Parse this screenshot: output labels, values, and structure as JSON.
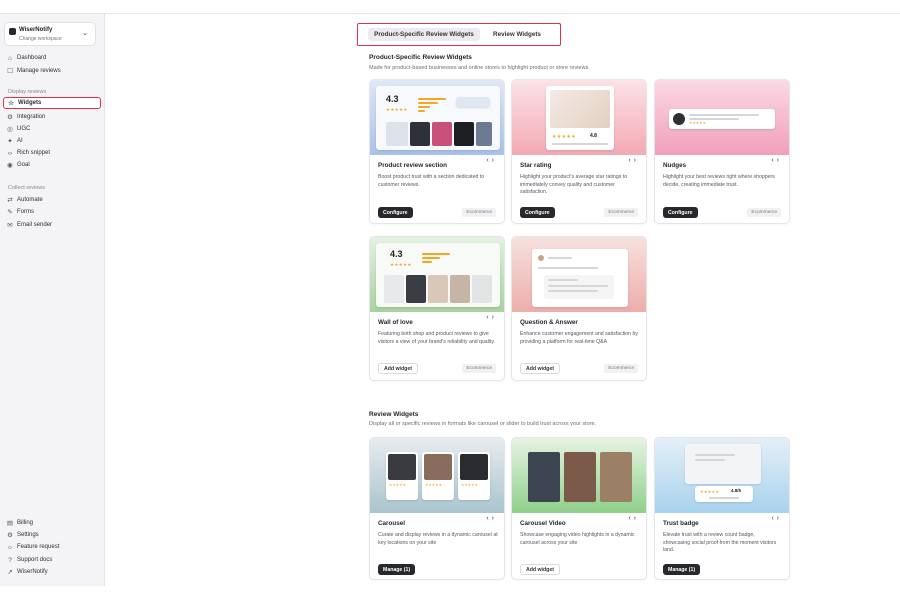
{
  "workspace": {
    "name": "WiserNotify",
    "subtitle": "Change workspace"
  },
  "sidebar": {
    "top_items": [
      {
        "label": "Dashboard",
        "icon": "home-icon"
      },
      {
        "label": "Manage reviews",
        "icon": "reviews-icon"
      }
    ],
    "display_label": "Display reviews",
    "display_items": [
      {
        "label": "Widgets",
        "icon": "star-icon",
        "active": true
      },
      {
        "label": "Integration",
        "icon": "integration-icon"
      },
      {
        "label": "UGC",
        "icon": "ugc-icon"
      },
      {
        "label": "AI",
        "icon": "ai-icon"
      },
      {
        "label": "Rich snippet",
        "icon": "code-icon"
      },
      {
        "label": "Goal",
        "icon": "goal-icon"
      }
    ],
    "collect_label": "Collect reviews",
    "collect_items": [
      {
        "label": "Automate",
        "icon": "automate-icon"
      },
      {
        "label": "Forms",
        "icon": "forms-icon"
      },
      {
        "label": "Email sender",
        "icon": "email-icon"
      }
    ],
    "bottom_items": [
      {
        "label": "Billing",
        "icon": "billing-icon"
      },
      {
        "label": "Settings",
        "icon": "settings-icon"
      },
      {
        "label": "Feature request",
        "icon": "bulb-icon"
      },
      {
        "label": "Support docs",
        "icon": "help-icon"
      },
      {
        "label": "WiserNotify",
        "icon": "external-link-icon"
      }
    ]
  },
  "tabs": {
    "active": "Product-Specific Review Widgets",
    "inactive": "Review Widgets"
  },
  "product_section": {
    "title": "Product-Specific Review Widgets",
    "description": "Made for product-based businesses and online stores to highlight product or store reviews.",
    "cards": [
      {
        "title": "Product review section",
        "description": "Boost product trust with a section dedicated to customer reviews.",
        "button": "Configure",
        "tag": "Ecommerce",
        "rating": "4.3"
      },
      {
        "title": "Star rating",
        "description": "Highlight your product's average star ratings to immediately convey quality and customer satisfaction.",
        "button": "Configure",
        "tag": "Ecommerce",
        "rating": "4.8"
      },
      {
        "title": "Nudges",
        "description": "Highlight your best reviews right where shoppers decide, creating immediate trust.",
        "button": "Configure",
        "tag": "Ecommerce"
      },
      {
        "title": "Wall of love",
        "description": "Featuring both shop and product reviews to give visitors a view of your brand's reliability and quality.",
        "button": "Add widget",
        "tag": "Ecommerce",
        "rating": "4.3"
      },
      {
        "title": "Question & Answer",
        "description": "Enhance customer engagement and satisfaction by providing a platform for real-time Q&A",
        "button": "Add widget",
        "tag": "Ecommerce"
      }
    ]
  },
  "review_section": {
    "title": "Review Widgets",
    "description": "Display all or specific reviews in formats like carousel or slider to build trust across your store.",
    "cards": [
      {
        "title": "Carousel",
        "description": "Curate and display reviews in a dynamic carousel at key locations on your site",
        "button": "Manage (1)"
      },
      {
        "title": "Carousel Video",
        "description": "Showcase engaging video highlights in a dynamic carousel across your site",
        "button": "Add widget"
      },
      {
        "title": "Trust badge",
        "description": "Elevate trust with a review count badge, showcasing social proof from the moment visitors land.",
        "button": "Manage (1)",
        "rating": "4.8/5"
      }
    ]
  },
  "colors": {
    "accent": "#e0304e",
    "dark_button": "#26282c",
    "star": "#f5a623"
  }
}
